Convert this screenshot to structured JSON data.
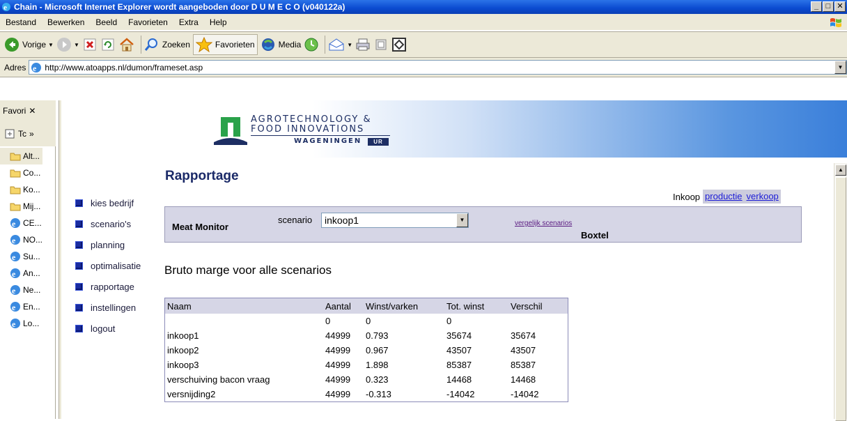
{
  "window": {
    "title": "Chain - Microsoft Internet Explorer wordt aangeboden door D U M E C O (v040122a)"
  },
  "menu": [
    "Bestand",
    "Bewerken",
    "Beeld",
    "Favorieten",
    "Extra",
    "Help"
  ],
  "toolbar": {
    "back_label": "Vorige",
    "search_label": "Zoeken",
    "favorites_label": "Favorieten",
    "media_label": "Media"
  },
  "address": {
    "label": "Adres",
    "url": "http://www.atoapps.nl/dumon/frameset.asp"
  },
  "favorites_pane": {
    "title": "Favori",
    "tools_label": "Tc",
    "items": [
      "Alt...",
      "Co...",
      "Ko...",
      "Mij...",
      "CE...",
      "NO...",
      "Su...",
      "An...",
      "Ne...",
      "En...",
      "Lo..."
    ]
  },
  "logo": {
    "line1": "AGROTECHNOLOGY &",
    "line2": "FOOD INNOVATIONS",
    "line3": "WAGENINGEN",
    "badge": "UR"
  },
  "sidenav": [
    "kies bedrijf",
    "scenario's",
    "planning",
    "optimalisatie",
    "rapportage",
    "instellingen",
    "logout"
  ],
  "page": {
    "title": "Rapportage",
    "report_nav": {
      "current": "Inkoop",
      "links": [
        "productie",
        "verkoop"
      ]
    },
    "panel": {
      "app_name": "Meat Monitor",
      "scenario_label": "scenario",
      "scenario_value": "inkoop1",
      "compare_link": "vergelijk scenarios",
      "location": "Boxtel"
    },
    "section_title": "Bruto marge voor alle scenarios",
    "table": {
      "headers": [
        "Naam",
        "Aantal",
        "Winst/varken",
        "Tot. winst",
        "Verschil"
      ],
      "rows": [
        [
          "",
          "0",
          "0",
          "0",
          ""
        ],
        [
          "inkoop1",
          "44999",
          "0.793",
          "35674",
          "35674"
        ],
        [
          "inkoop2",
          "44999",
          "0.967",
          "43507",
          "43507"
        ],
        [
          "inkoop3",
          "44999",
          "1.898",
          "85387",
          "85387"
        ],
        [
          "verschuiving bacon vraag",
          "44999",
          "0.323",
          "14468",
          "14468"
        ],
        [
          "versnijding2",
          "44999",
          "-0.313",
          "-14042",
          "-14042"
        ]
      ]
    }
  },
  "colors": {
    "nav_bullet": "#1a2ca0",
    "link": "#1b1bd6",
    "title": "#1b2a68",
    "panel_bg": "#d6d6e6"
  }
}
